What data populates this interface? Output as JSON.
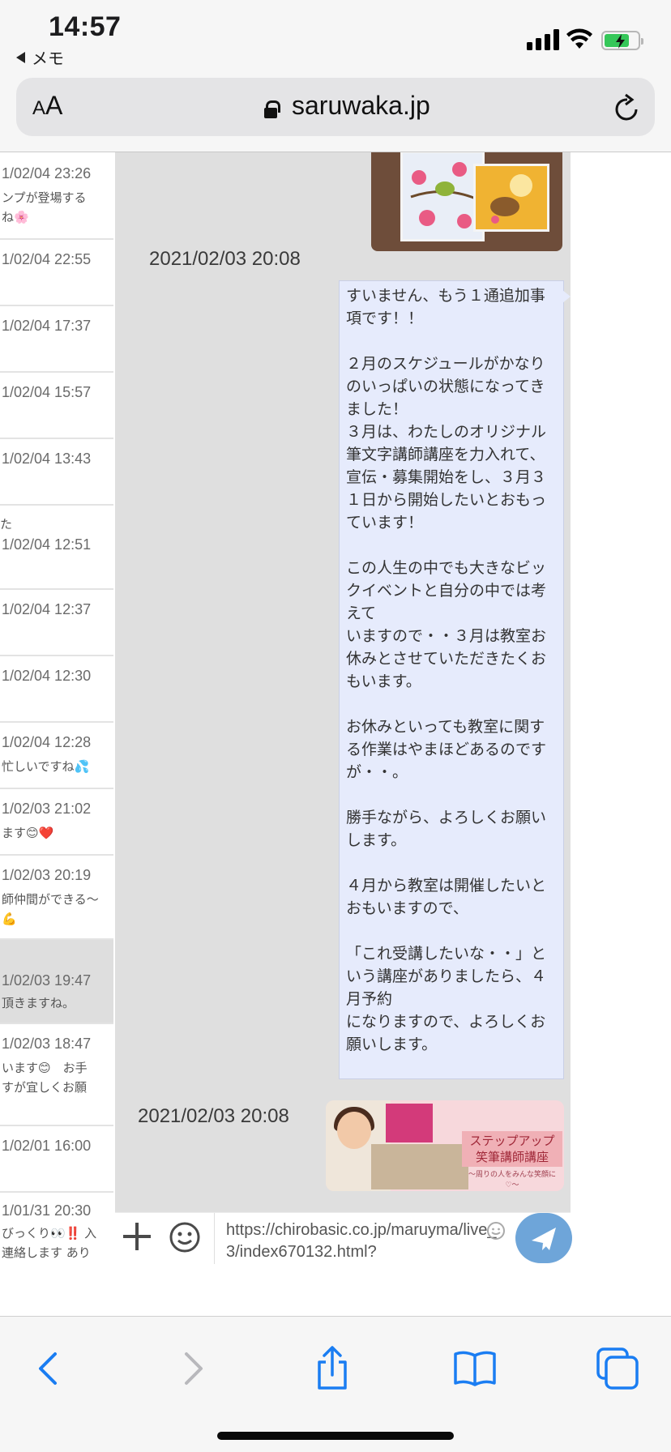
{
  "status_bar": {
    "time": "14:57",
    "back_app": "メモ"
  },
  "browser": {
    "text_size_small": "A",
    "text_size_large": "A",
    "url": "saruwaka.jp"
  },
  "conversations": [
    {
      "date": "1/02/04 23:26",
      "preview": "ンプが登場する",
      "preview2": "ね🌸"
    },
    {
      "date": "1/02/04 22:55",
      "preview": "",
      "preview2": ""
    },
    {
      "date": "1/02/04 17:37",
      "preview": "",
      "preview2": ""
    },
    {
      "date": "1/02/04 15:57",
      "preview": "",
      "preview2": ""
    },
    {
      "date": "1/02/04 13:43",
      "preview": "",
      "preview2": ""
    },
    {
      "date": "1/02/04 12:51",
      "preview": "",
      "preview2": ""
    },
    {
      "date": "1/02/04 12:37",
      "preview": "",
      "preview2": ""
    },
    {
      "date": "1/02/04 12:30",
      "preview": "",
      "preview2": ""
    },
    {
      "date": "1/02/04 12:28",
      "preview": "忙しいですね💦",
      "preview2": ""
    },
    {
      "date": "1/02/03 21:02",
      "preview": "ます😊❤️",
      "preview2": ""
    },
    {
      "date": "1/02/03 20:19",
      "preview": "師仲間ができる〜",
      "preview2": "💪"
    },
    {
      "date": "1/02/03 19:47",
      "preview": "頂きますね。",
      "preview2": ""
    },
    {
      "date": "1/02/03 18:47",
      "preview": "います😊　お手",
      "preview2": "すが宜しくお願"
    },
    {
      "date": "1/02/01 16:00",
      "preview": "",
      "preview2": ""
    },
    {
      "date": "1/01/31 20:30",
      "preview": "びっくり👀‼️ 入",
      "preview2": "連絡します あり"
    }
  ],
  "conversation_extra": "た",
  "chat": {
    "message_time": "2021/02/03 20:08",
    "message_text": "すいません、もう１通追加事項です！！\n\n２月のスケジュールがかなりのいっぱいの状態になってきました！\n３月は、わたしのオリジナル筆文字講師講座を力入れて、\n宣伝・募集開始をし、３月３１日から開始したいとおもっています！\n\nこの人生の中でも大きなビックイベントと自分の中では考えて\nいますので・・３月は教室お休みとさせていただきたくおもいます。\n\nお休みといっても教室に関する作業はやまほどあるのですが・・。\n\n勝手ながら、よろしくお願いします。\n\n４月から教室は開催したいとおもいますので、\n\n「これ受講したいな・・」という講座がありましたら、４月予約\nになりますので、よろしくお願いします。",
    "image_time": "2021/02/03 20:08",
    "image_title": "ステップアップ\n笑筆講師講座",
    "image_subtitle": "〜周りの人をみんな笑顔に♡〜"
  },
  "composer": {
    "value": "https://chirobasic.co.jp/maruyma/live_3/index670132.html?"
  },
  "colors": {
    "bubble": "#e6ebfc",
    "send": "#6ea5d9",
    "chat_bg": "#dfdfdf",
    "ios_blue": "#1a7df2"
  }
}
